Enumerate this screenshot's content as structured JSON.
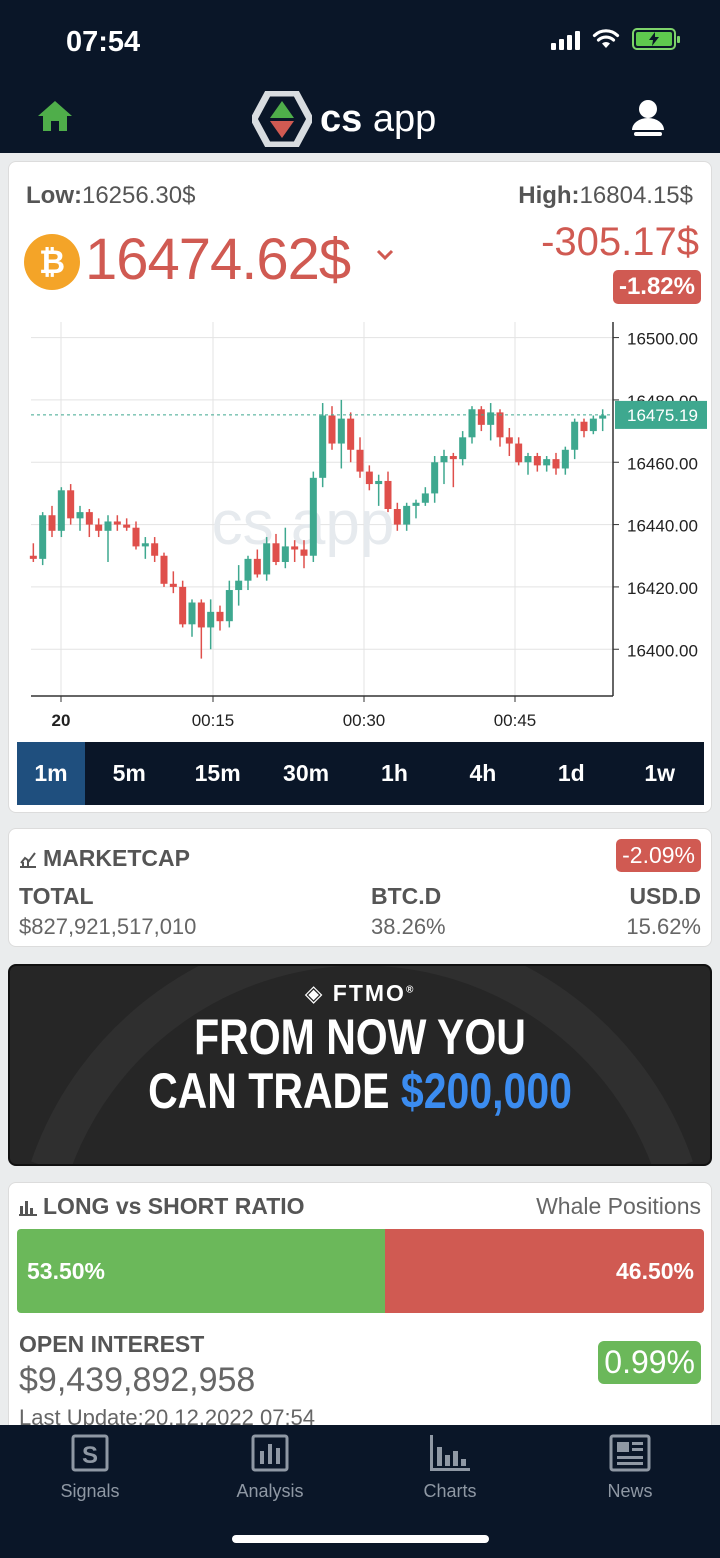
{
  "status": {
    "time": "07:54"
  },
  "header": {
    "logo_cs": "cs",
    "logo_app": "app"
  },
  "ticker": {
    "low_label": "Low:",
    "low_value": "16256.30$",
    "high_label": "High:",
    "high_value": "16804.15$",
    "coin_symbol": "₿",
    "price": "16474.62$",
    "change_abs": "-305.17$",
    "change_pct": "-1.82%"
  },
  "chart_data": {
    "type": "candlestick",
    "x_ticks": [
      "20",
      "00:15",
      "00:30",
      "00:45"
    ],
    "y_ticks": [
      "16500.00",
      "16480.00",
      "16460.00",
      "16440.00",
      "16420.00",
      "16400.00"
    ],
    "ylim": [
      16385,
      16505
    ],
    "last_price": "16475.19",
    "watermark": "cs app",
    "candles": [
      [
        16430,
        16434,
        16428,
        16429
      ],
      [
        16429,
        16444,
        16427,
        16443
      ],
      [
        16443,
        16446,
        16436,
        16438
      ],
      [
        16438,
        16452,
        16436,
        16451
      ],
      [
        16451,
        16453,
        16440,
        16442
      ],
      [
        16442,
        16446,
        16438,
        16444
      ],
      [
        16444,
        16445,
        16436,
        16440
      ],
      [
        16440,
        16442,
        16436,
        16438
      ],
      [
        16438,
        16443,
        16428,
        16441
      ],
      [
        16441,
        16443,
        16438,
        16440
      ],
      [
        16440,
        16442,
        16438,
        16439
      ],
      [
        16439,
        16441,
        16432,
        16433
      ],
      [
        16433,
        16436,
        16429,
        16434
      ],
      [
        16434,
        16436,
        16428,
        16430
      ],
      [
        16430,
        16431,
        16420,
        16421
      ],
      [
        16421,
        16425,
        16418,
        16420
      ],
      [
        16420,
        16422,
        16407,
        16408
      ],
      [
        16408,
        16416,
        16404,
        16415
      ],
      [
        16415,
        16416,
        16397,
        16407
      ],
      [
        16407,
        16416,
        16400,
        16412
      ],
      [
        16412,
        16414,
        16406,
        16409
      ],
      [
        16409,
        16422,
        16407,
        16419
      ],
      [
        16419,
        16427,
        16414,
        16422
      ],
      [
        16422,
        16430,
        16419,
        16429
      ],
      [
        16429,
        16432,
        16423,
        16424
      ],
      [
        16424,
        16436,
        16422,
        16434
      ],
      [
        16434,
        16437,
        16427,
        16428
      ],
      [
        16428,
        16439,
        16426,
        16433
      ],
      [
        16433,
        16435,
        16428,
        16432
      ],
      [
        16432,
        16435,
        16426,
        16430
      ],
      [
        16430,
        16457,
        16428,
        16455
      ],
      [
        16455,
        16479,
        16452,
        16475
      ],
      [
        16475,
        16478,
        16464,
        16466
      ],
      [
        16466,
        16480,
        16458,
        16474
      ],
      [
        16474,
        16476,
        16460,
        16464
      ],
      [
        16464,
        16468,
        16455,
        16457
      ],
      [
        16457,
        16459,
        16451,
        16453
      ],
      [
        16453,
        16456,
        16446,
        16454
      ],
      [
        16454,
        16457,
        16444,
        16445
      ],
      [
        16445,
        16447,
        16438,
        16440
      ],
      [
        16440,
        16447,
        16438,
        16446
      ],
      [
        16446,
        16448,
        16442,
        16447
      ],
      [
        16447,
        16452,
        16446,
        16450
      ],
      [
        16450,
        16462,
        16447,
        16460
      ],
      [
        16460,
        16464,
        16453,
        16462
      ],
      [
        16462,
        16463,
        16452,
        16461
      ],
      [
        16461,
        16470,
        16459,
        16468
      ],
      [
        16468,
        16478,
        16466,
        16477
      ],
      [
        16477,
        16478,
        16470,
        16472
      ],
      [
        16472,
        16479,
        16467,
        16476
      ],
      [
        16476,
        16477,
        16465,
        16468
      ],
      [
        16468,
        16471,
        16462,
        16466
      ],
      [
        16466,
        16468,
        16459,
        16460
      ],
      [
        16460,
        16463,
        16456,
        16462
      ],
      [
        16462,
        16463,
        16457,
        16459
      ],
      [
        16459,
        16462,
        16457,
        16461
      ],
      [
        16461,
        16463,
        16456,
        16458
      ],
      [
        16458,
        16465,
        16456,
        16464
      ],
      [
        16464,
        16474,
        16461,
        16473
      ],
      [
        16473,
        16474,
        16468,
        16470
      ],
      [
        16470,
        16475,
        16469,
        16474
      ],
      [
        16474,
        16477,
        16470,
        16475
      ]
    ]
  },
  "timeframes": [
    "1m",
    "5m",
    "15m",
    "30m",
    "1h",
    "4h",
    "1d",
    "1w"
  ],
  "marketcap": {
    "title": "MARKETCAP",
    "change": "-2.09%",
    "total_label": "TOTAL",
    "total_value": "$827,921,517,010",
    "btcd_label": "BTC.D",
    "btcd_value": "38.26%",
    "usdd_label": "USD.D",
    "usdd_value": "15.62%"
  },
  "ad": {
    "brand": "FTMO",
    "line1": "FROM NOW YOU",
    "line2_prefix": "CAN TRADE",
    "line2_amount": "$200,000"
  },
  "ratio": {
    "title": "LONG vs SHORT RATIO",
    "subtitle": "Whale Positions",
    "long_pct": "53.50%",
    "short_pct": "46.50%",
    "long_fraction": 0.535
  },
  "open_interest": {
    "title": "OPEN INTEREST",
    "value": "$9,439,892,958",
    "change": "0.99%",
    "last_update": "Last Update:20.12.2022 07:54"
  },
  "tabs": [
    {
      "label": "Signals",
      "icon": "signals-icon"
    },
    {
      "label": "Analysis",
      "icon": "analysis-icon"
    },
    {
      "label": "Charts",
      "icon": "charts-icon"
    },
    {
      "label": "News",
      "icon": "news-icon"
    }
  ]
}
